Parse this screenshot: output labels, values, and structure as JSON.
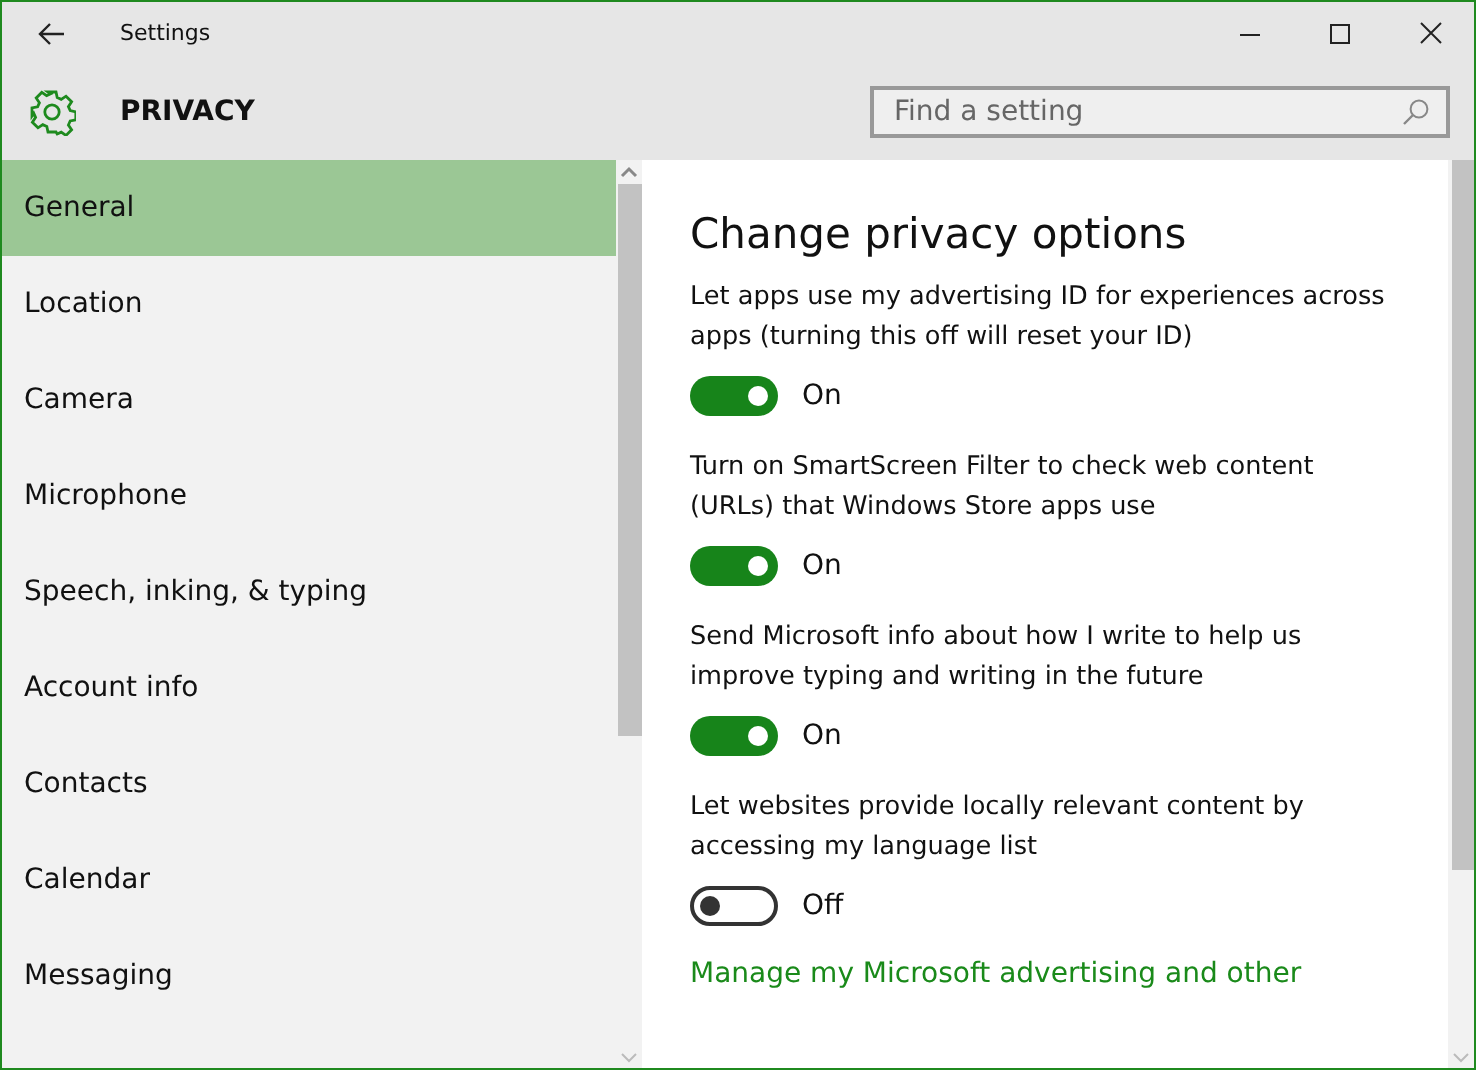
{
  "window": {
    "title": "Settings"
  },
  "header": {
    "title": "PRIVACY",
    "search": {
      "placeholder": "Find a setting"
    }
  },
  "sidebar": {
    "items": [
      {
        "label": "General",
        "selected": true
      },
      {
        "label": "Location",
        "selected": false
      },
      {
        "label": "Camera",
        "selected": false
      },
      {
        "label": "Microphone",
        "selected": false
      },
      {
        "label": "Speech, inking, & typing",
        "selected": false
      },
      {
        "label": "Account info",
        "selected": false
      },
      {
        "label": "Contacts",
        "selected": false
      },
      {
        "label": "Calendar",
        "selected": false
      },
      {
        "label": "Messaging",
        "selected": false
      }
    ]
  },
  "content": {
    "heading": "Change privacy options",
    "options": [
      {
        "description": "Let apps use my advertising ID for experiences across apps (turning this off will reset your ID)",
        "on": true,
        "state_label": "On"
      },
      {
        "description": "Turn on SmartScreen Filter to check web content (URLs) that Windows Store apps use",
        "on": true,
        "state_label": "On"
      },
      {
        "description": "Send Microsoft info about how I write to help us improve typing and writing in the future",
        "on": true,
        "state_label": "On"
      },
      {
        "description": "Let websites provide locally relevant content by accessing my language list",
        "on": false,
        "state_label": "Off"
      }
    ],
    "link": "Manage my Microsoft advertising and other"
  }
}
